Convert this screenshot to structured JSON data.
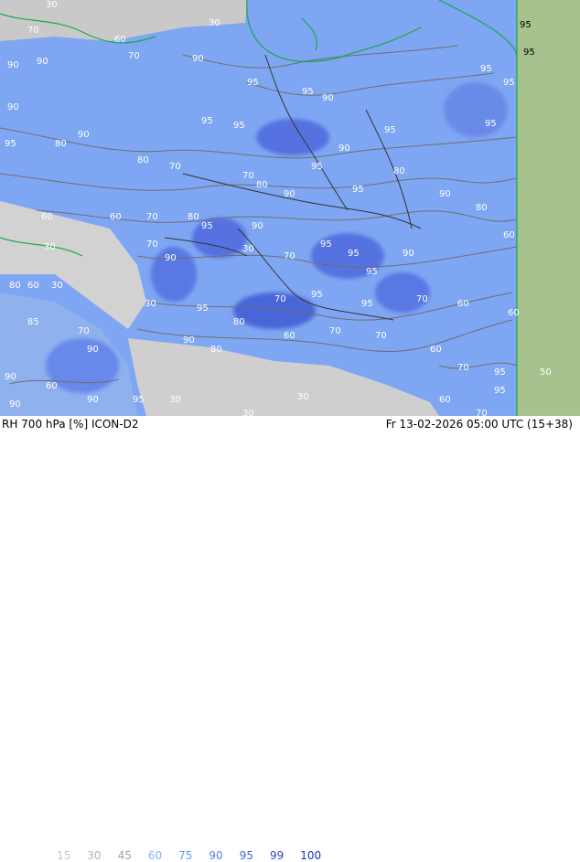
{
  "title": "RH 700 hPa [%] ICON-D2",
  "valid_time": "Fr 13-02-2026 05:00 UTC (15+38)",
  "legend": {
    "levels": [
      {
        "label": "15",
        "color": "#c8c8c8"
      },
      {
        "label": "30",
        "color": "#b4b4b4"
      },
      {
        "label": "45",
        "color": "#a0a0a0"
      },
      {
        "label": "60",
        "color": "#82b4ff"
      },
      {
        "label": "75",
        "color": "#6496ff"
      },
      {
        "label": "90",
        "color": "#5a82e6"
      },
      {
        "label": "95",
        "color": "#4664dc"
      },
      {
        "label": "99",
        "color": "#3246c8"
      },
      {
        "label": "100",
        "color": "#1e32b4"
      }
    ]
  },
  "colors": {
    "domain_fill": "#7fa6f2",
    "outside_fill": "#e0e0e0",
    "dry_fill": "#c7c7c7",
    "coastline": "#18a848",
    "border": "#333333",
    "contour": "#6e6e6e",
    "frame_strip": "#a0c080"
  },
  "contour_labels": [
    "30",
    "60",
    "70",
    "80",
    "90",
    "95"
  ]
}
